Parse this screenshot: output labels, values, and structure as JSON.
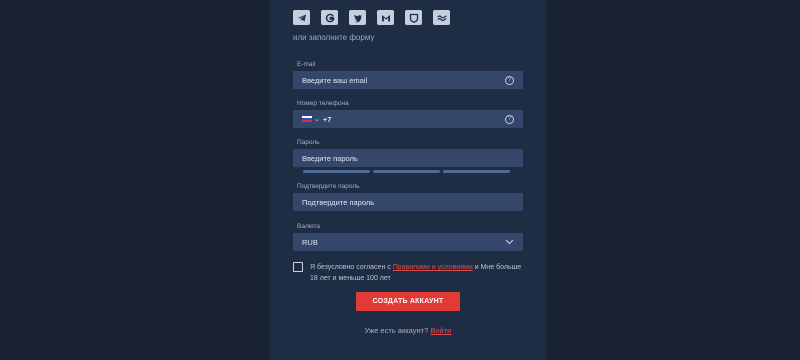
{
  "social": [
    {
      "icon": "telegram-icon"
    },
    {
      "icon": "google-icon"
    },
    {
      "icon": "twitter-icon"
    },
    {
      "icon": "mail-icon"
    },
    {
      "icon": "shield-icon"
    },
    {
      "icon": "steam-icon"
    }
  ],
  "form": {
    "or_text": "или заполните форму",
    "email": {
      "label": "E-mail",
      "placeholder": "Введите ваш email"
    },
    "phone": {
      "label": "Номер телефона",
      "prefix": "+7"
    },
    "password": {
      "label": "Пароль",
      "placeholder": "Введите пароль"
    },
    "confirm": {
      "label": "Подтвердите пароль",
      "placeholder": "Подтвердите пароль"
    },
    "currency": {
      "label": "Валюта",
      "value": "RUB"
    },
    "agree": {
      "pre": "Я безусловно согласен с ",
      "link": "Правилами и условиями",
      "post": " и Мне больше 18 лет и меньше 100 лет"
    },
    "submit_label": "СОЗДАТЬ АККАУНТ",
    "login": {
      "question": "Уже есть аккаунт? ",
      "link": "Войти"
    }
  },
  "colors": {
    "accent": "#e23b35",
    "panel": "#1f2d44",
    "field": "#34466a"
  }
}
